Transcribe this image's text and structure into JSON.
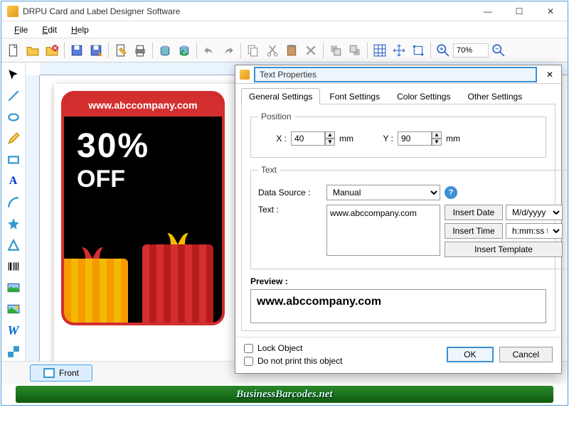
{
  "window": {
    "title": "DRPU Card and Label Designer Software"
  },
  "menubar": {
    "file": "File",
    "edit": "Edit",
    "help": "Help"
  },
  "toolbar": {
    "zoom": "70%"
  },
  "canvas_card": {
    "url_text": "www.abccompany.com",
    "big_text": "30%",
    "off_text": "OFF"
  },
  "page_tabs": {
    "front": "Front"
  },
  "footer_ad": "BusinessBarcodes.net",
  "dialog": {
    "title": "Text Properties",
    "tabs": {
      "general": "General Settings",
      "font": "Font Settings",
      "color": "Color Settings",
      "other": "Other Settings"
    },
    "position": {
      "legend": "Position",
      "x_label": "X :",
      "x_value": "40",
      "x_unit": "mm",
      "y_label": "Y :",
      "y_value": "90",
      "y_unit": "mm"
    },
    "text_section": {
      "legend": "Text",
      "ds_label": "Data Source :",
      "ds_value": "Manual",
      "text_label": "Text :",
      "text_value": "www.abccompany.com",
      "insert_date": "Insert Date",
      "date_format": "M/d/yyyy",
      "insert_time": "Insert Time",
      "time_format": "h:mm:ss tt",
      "insert_template": "Insert Template"
    },
    "preview": {
      "label": "Preview :",
      "value": "www.abccompany.com"
    },
    "lock": "Lock Object",
    "noprint": "Do not print this object",
    "ok": "OK",
    "cancel": "Cancel"
  }
}
